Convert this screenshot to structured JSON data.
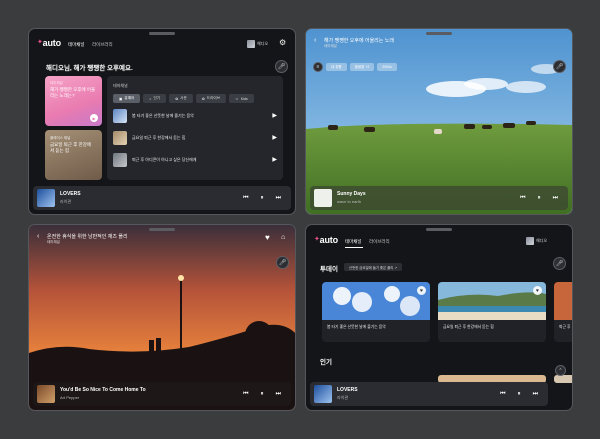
{
  "home": {
    "logo": "auto",
    "nav": [
      "테마채널",
      "라이브러리"
    ],
    "profile_name": "해디오",
    "greeting": "해디오님, 해가 쨍쨍한 오후예요.",
    "pink_card": {
      "label": "테마채널",
      "title": "해가 쨍쨍한 오후에 어울리는 노래는?"
    },
    "tan_card": {
      "label": "플레이스 채널",
      "title": "금요일 퇴근 후 한강에서 듣는 힙"
    },
    "panel_title": "테마채널",
    "chips": [
      "뮤예어",
      "인기",
      "사운",
      "드라이브",
      "Kids"
    ],
    "playlists": [
      "봄 타기 좋은 산뜻한 날에 즐기는 음악",
      "금요일 퇴근 후 한강에서 듣는 힙",
      "퇴근 후 아디콘이 아니고 싶은 당신에게"
    ],
    "player": {
      "title": "LOVERS",
      "artist": "라이관"
    }
  },
  "detail_field": {
    "title": "해가 쨍쨍한 오후에 어울리는 노래",
    "subtitle": "테마채널",
    "tags": [
      "내 취향",
      "힐링팝 +2",
      "2000s"
    ],
    "player": {
      "title": "Sunny Days",
      "artist": "wave to earth"
    }
  },
  "detail_jazz": {
    "title": "온전한 휴식을 위한 낭만적인 재즈 플리",
    "subtitle": "테마채널",
    "player": {
      "title": "You'd Be So Nice To Come Home To",
      "artist": "Art Pepper"
    }
  },
  "theme": {
    "logo": "auto",
    "nav": [
      "테마채널",
      "라이브러리"
    ],
    "profile_name": "해디오",
    "today_label": "투데이",
    "today_pill": "산뜻한 금요일에 들기 좋은 플리 ↗",
    "cards": [
      "봄 타기 좋은 산뜻한 날에 즐기는 음악",
      "금요일 퇴근 후 한강에서 듣는 힙",
      "퇴근 후"
    ],
    "popular_label": "인기",
    "player": {
      "title": "LOVERS",
      "artist": "라이관"
    }
  },
  "colors": {
    "accent_pink": "#e8508c",
    "panel": "#24262b",
    "frame": "#141518"
  }
}
